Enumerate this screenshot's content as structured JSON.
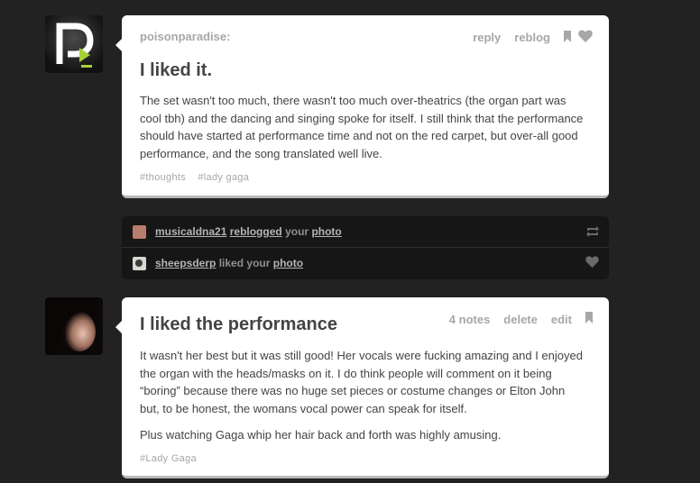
{
  "post1": {
    "username": "poisonparadise:",
    "controls": {
      "reply": "reply",
      "reblog": "reblog"
    },
    "title": "I liked it.",
    "body": "The set wasn't too much, there wasn't too much over-theatrics (the organ part was cool tbh) and the dancing and singing spoke for itself. I still think that the performance should have started at performance time and not on the red carpet, but over-all good performance, and the song translated well live.",
    "tags": [
      "#thoughts",
      "#lady gaga"
    ]
  },
  "notifications": [
    {
      "user": "musicaldna21",
      "action": "reblogged",
      "mid": "your",
      "object": "photo",
      "icon": "reblog-icon"
    },
    {
      "user": "sheepsderp",
      "action": "liked",
      "mid": "your",
      "object": "photo",
      "icon": "heart-icon"
    }
  ],
  "post2": {
    "title": "I liked the performance",
    "controls": {
      "notes": "4 notes",
      "delete": "delete",
      "edit": "edit"
    },
    "paragraphs": [
      "It wasn't her best but it was still good! Her vocals were fucking amazing and I enjoyed the organ with the heads/masks on it. I do think people will comment on it being “boring” because there was no huge set pieces or costume changes or Elton John but, to be honest, the womans vocal power can speak for itself.",
      "Plus watching Gaga whip her hair back and forth was highly amusing."
    ],
    "tags": [
      "#Lady Gaga"
    ]
  },
  "colors": {
    "background": "#222222",
    "card": "#ffffff",
    "muted": "#a7a7a7",
    "text": "#444444",
    "notes_bg": "#161616"
  }
}
